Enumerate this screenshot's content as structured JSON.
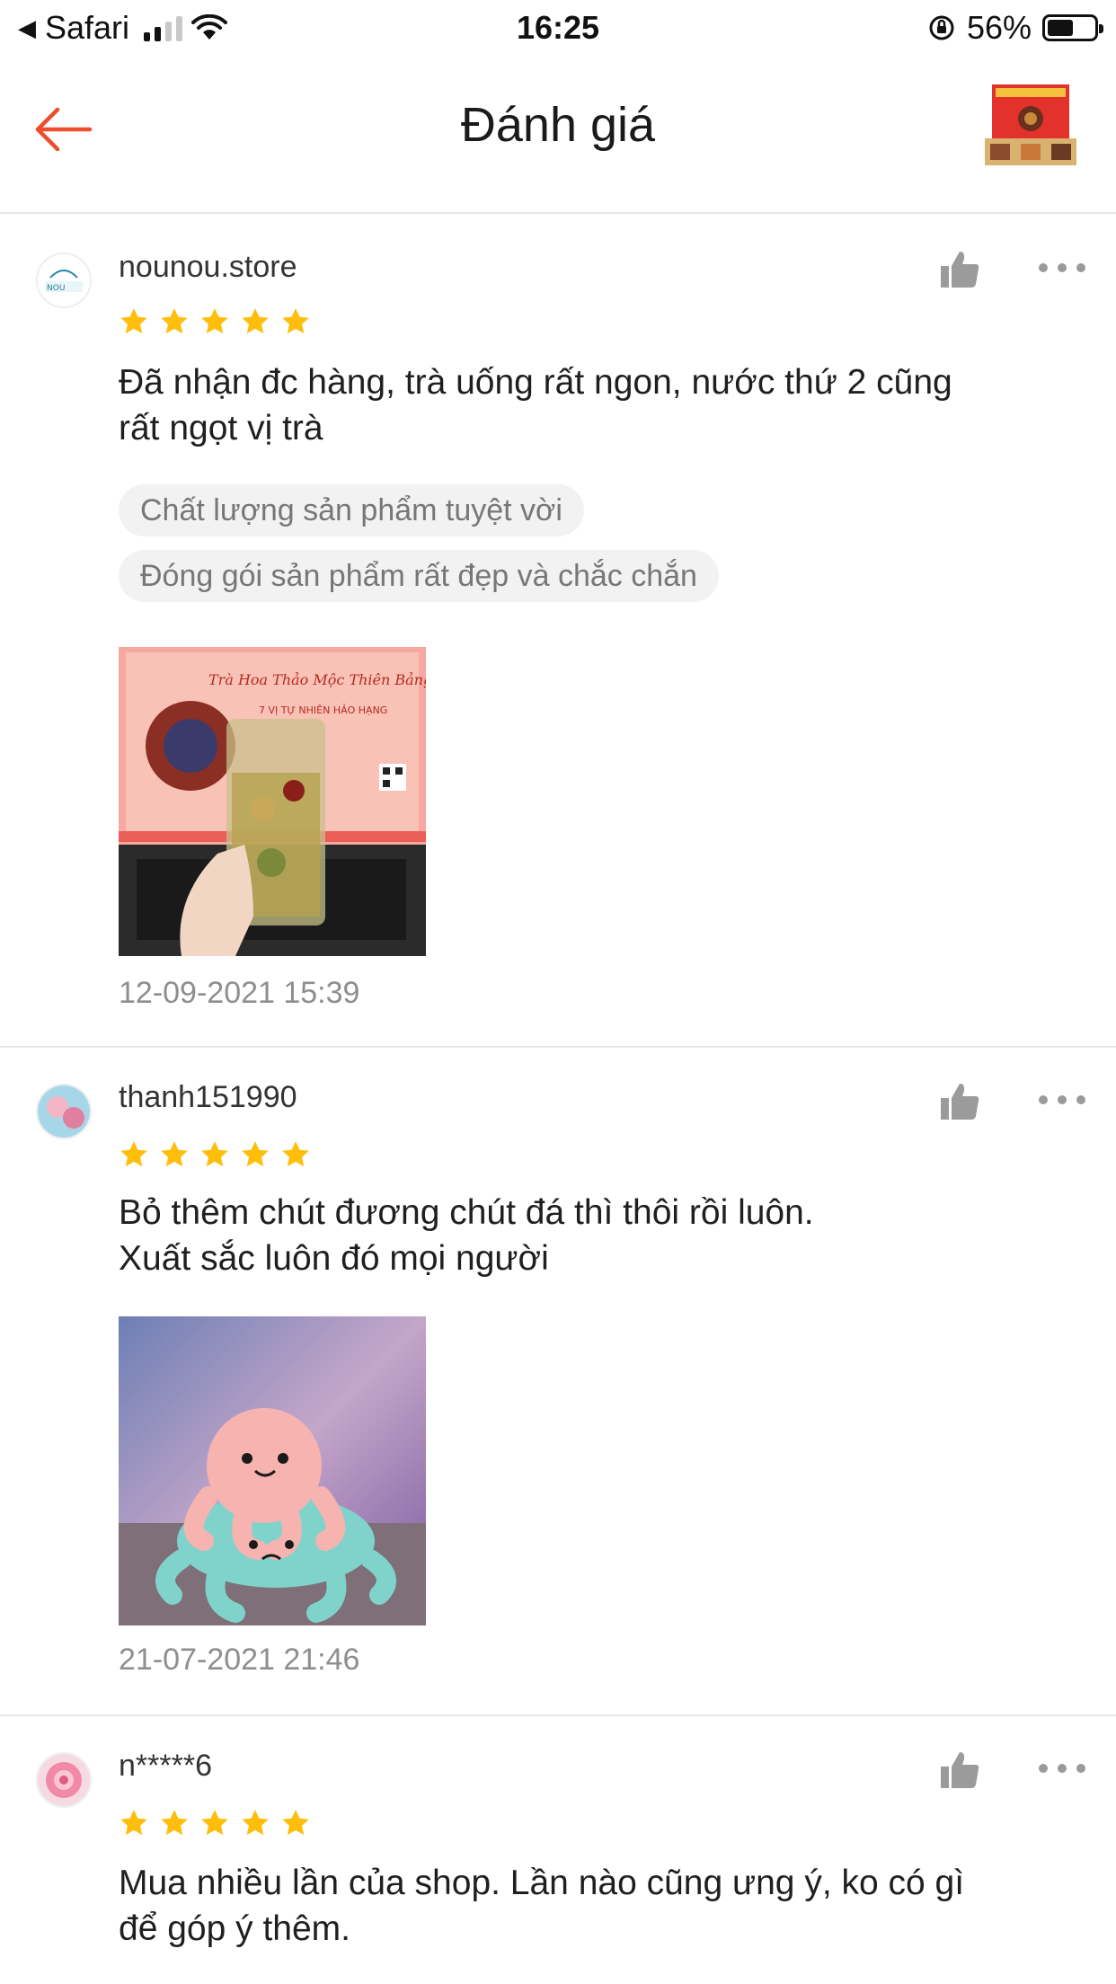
{
  "status_bar": {
    "carrier": "Safari",
    "time": "16:25",
    "battery": "56%",
    "battery_level": 0.56
  },
  "header": {
    "title": "Đánh giá",
    "back_icon": "arrow-left-icon",
    "accent_color": "#ee4d2d"
  },
  "reviews": [
    {
      "username": "nounou.store",
      "rating": 5,
      "text_lines": [
        "Đã nhận đc hàng, trà uống rất ngon, nước thứ 2 cũng",
        "rất ngọt vị trà"
      ],
      "tags": [
        "Chất lượng sản phẩm tuyệt vời",
        "Đóng gói sản phẩm rất đẹp và chắc chắn"
      ],
      "image_banner_title": "Trà Hoa Thảo Mộc Thiên Bảng",
      "image_banner_subtitle": "7 VỊ TỰ NHIÊN HẢO HẠNG",
      "date": "12-09-2021 15:39"
    },
    {
      "username": "thanh151990",
      "rating": 5,
      "text_lines": [
        "Bỏ thêm chút đương chút đá thì thôi rồi luôn.",
        "Xuất sắc luôn đó mọi người"
      ],
      "date": "21-07-2021 21:46"
    },
    {
      "username": "n*****6",
      "rating": 5,
      "text_lines": [
        "Mua nhiều lần của shop. Lần nào cũng ưng ý, ko có gì",
        "để góp ý thêm."
      ]
    }
  ],
  "star_color": "#ffbe0b"
}
